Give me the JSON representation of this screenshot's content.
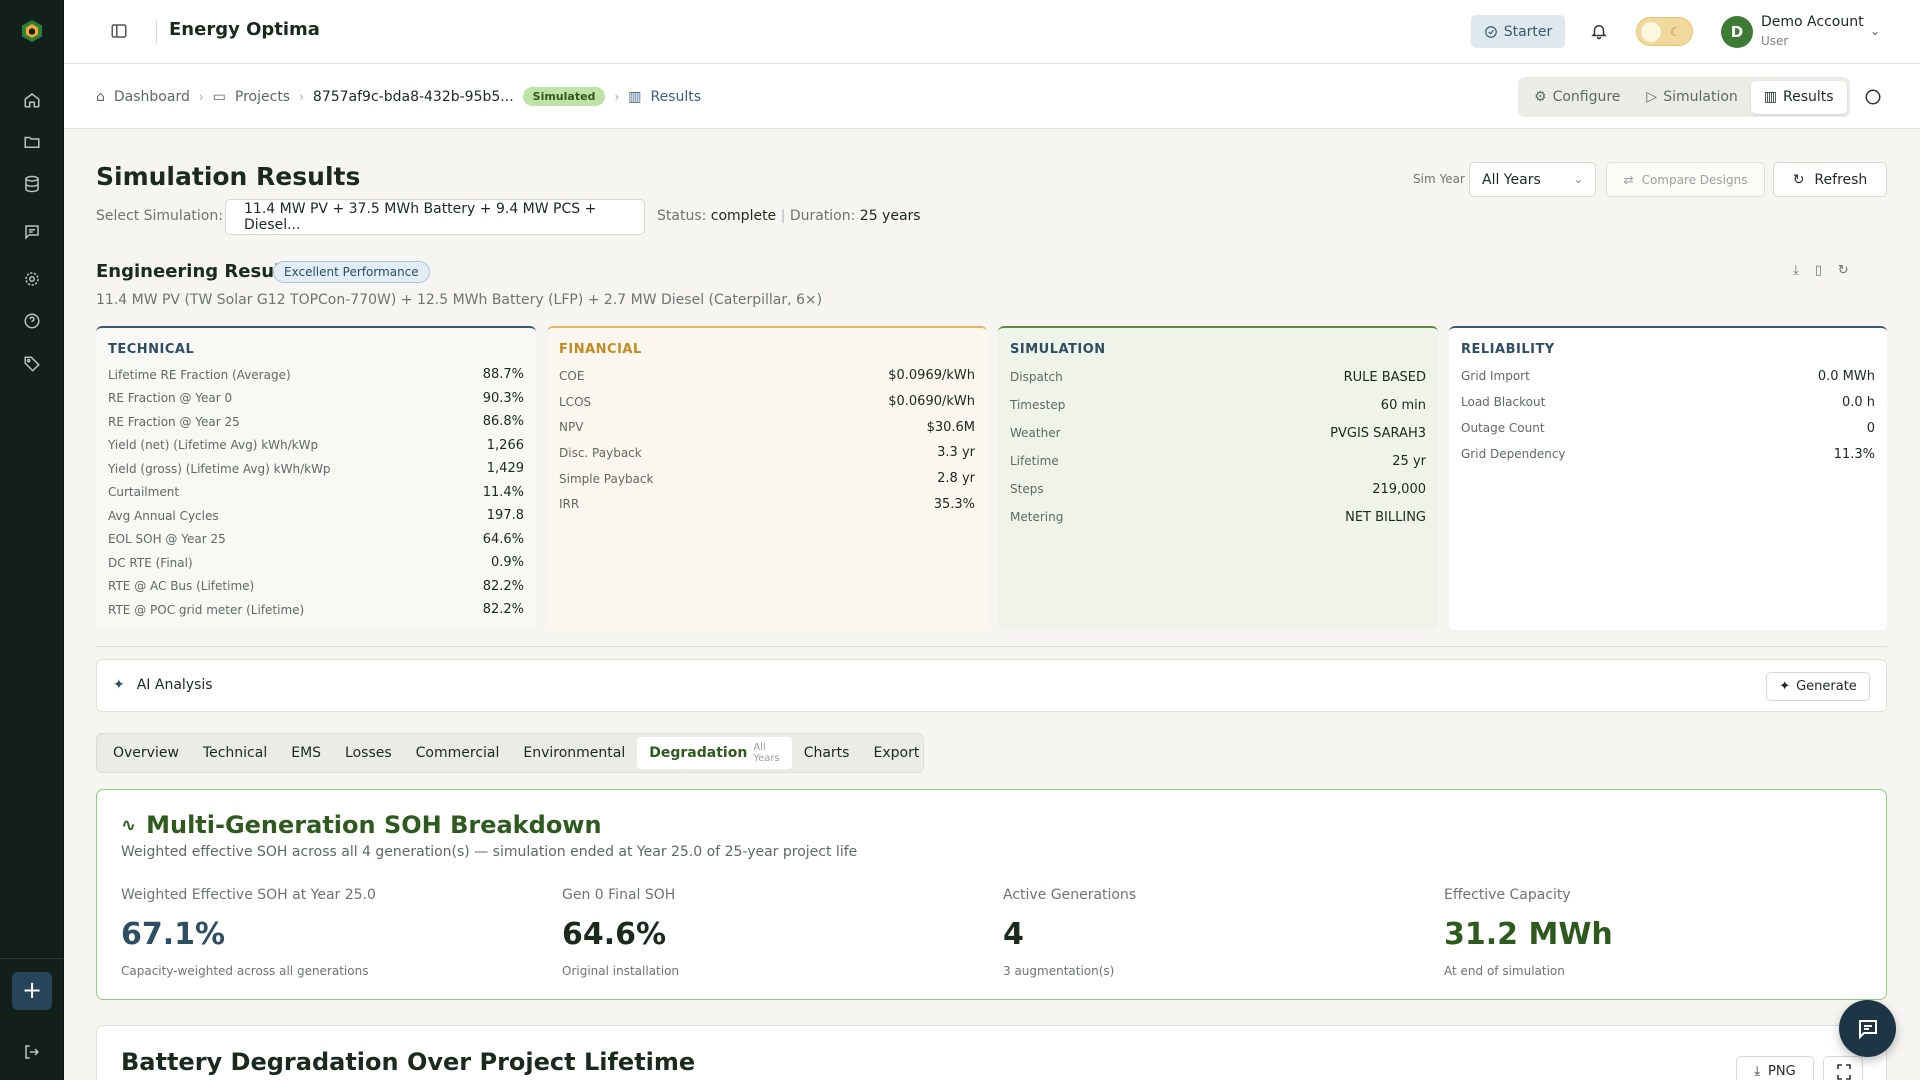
{
  "app": {
    "title": "Energy Optima",
    "plan": "Starter",
    "account_name": "Demo Account",
    "account_role": "User",
    "avatar_letter": "D"
  },
  "sidebar": {
    "items": [
      "home-icon",
      "folder-icon",
      "database-icon",
      "message-icon",
      "settings-icon",
      "help-icon",
      "tag-icon"
    ],
    "add_label": "+"
  },
  "breadcrumb": {
    "dashboard": "Dashboard",
    "projects": "Projects",
    "project_id": "8757af9c-bda8-432b-95b5...",
    "status_badge": "Simulated",
    "results": "Results"
  },
  "view_tabs": {
    "configure": "Configure",
    "simulation": "Simulation",
    "results": "Results"
  },
  "page": {
    "title": "Simulation Results",
    "sim_year_label": "Sim Year",
    "sim_year_value": "All Years",
    "compare_label": "Compare Designs",
    "refresh_label": "Refresh",
    "select_sim_label": "Select Simulation:",
    "selected_sim": "11.4 MW PV + 37.5 MWh Battery + 9.4 MW PCS + Diesel...",
    "status_label": "Status:",
    "status_value": "complete",
    "duration_label": "Duration:",
    "duration_value": "25 years"
  },
  "engineering": {
    "title": "Engineering Results",
    "badge": "Excellent Performance",
    "subtitle": "11.4 MW PV (TW Solar G12 TOPCon-770W) + 12.5 MWh Battery (LFP) + 2.7 MW Diesel (Caterpillar, 6×)"
  },
  "technical": {
    "title": "TECHNICAL",
    "rows": [
      {
        "label": "Lifetime RE Fraction (Average)",
        "value": "88.7%"
      },
      {
        "label": "RE Fraction @ Year 0",
        "value": "90.3%"
      },
      {
        "label": "RE Fraction @ Year 25",
        "value": "86.8%"
      },
      {
        "label": "Yield (net) (Lifetime Avg) kWh/kWp",
        "value": "1,266"
      },
      {
        "label": "Yield (gross) (Lifetime Avg) kWh/kWp",
        "value": "1,429"
      },
      {
        "label": "Curtailment",
        "value": "11.4%"
      },
      {
        "label": "Avg Annual Cycles",
        "value": "197.8"
      },
      {
        "label": "EOL SOH @ Year 25",
        "value": "64.6%"
      },
      {
        "label": "DC RTE (Final)",
        "value": "0.9%"
      },
      {
        "label": "RTE @ AC Bus (Lifetime)",
        "value": "82.2%"
      },
      {
        "label": "RTE @ POC grid meter (Lifetime)",
        "value": "82.2%"
      }
    ]
  },
  "financial": {
    "title": "FINANCIAL",
    "rows": [
      {
        "label": "COE",
        "value": "$0.0969/kWh"
      },
      {
        "label": "LCOS",
        "value": "$0.0690/kWh"
      },
      {
        "label": "NPV",
        "value": "$30.6M"
      },
      {
        "label": "Disc. Payback",
        "value": "3.3 yr"
      },
      {
        "label": "Simple Payback",
        "value": "2.8 yr"
      },
      {
        "label": "IRR",
        "value": "35.3%"
      }
    ]
  },
  "simulation": {
    "title": "SIMULATION",
    "rows": [
      {
        "label": "Dispatch",
        "value": "RULE BASED"
      },
      {
        "label": "Timestep",
        "value": "60 min"
      },
      {
        "label": "Weather",
        "value": "PVGIS SARAH3"
      },
      {
        "label": "Lifetime",
        "value": "25 yr"
      },
      {
        "label": "Steps",
        "value": "219,000"
      },
      {
        "label": "Metering",
        "value": "NET BILLING"
      }
    ]
  },
  "reliability": {
    "title": "RELIABILITY",
    "rows": [
      {
        "label": "Grid Import",
        "value": "0.0 MWh"
      },
      {
        "label": "Load Blackout",
        "value": "0.0 h"
      },
      {
        "label": "Outage Count",
        "value": "0"
      },
      {
        "label": "Grid Dependency",
        "value": "11.3%"
      }
    ]
  },
  "ai": {
    "label": "AI Analysis",
    "generate_label": "Generate"
  },
  "tabs": {
    "items": [
      "Overview",
      "Technical",
      "EMS",
      "Losses",
      "Commercial",
      "Environmental",
      "Degradation",
      "Charts",
      "Export"
    ],
    "active_note": "All Years"
  },
  "soh": {
    "title": "Multi-Generation SOH Breakdown",
    "subtitle": "Weighted effective SOH across all 4 generation(s) — simulation ended at Year 25.0 of 25-year project life",
    "metrics": [
      {
        "label": "Weighted Effective SOH at Year 25.0",
        "value": "67.1%",
        "sub": "Capacity-weighted across all generations",
        "color": "#2f4d63"
      },
      {
        "label": "Gen 0 Final SOH",
        "value": "64.6%",
        "sub": "Original installation",
        "color": "#1a2a1e"
      },
      {
        "label": "Active Generations",
        "value": "4",
        "sub": "3 augmentation(s)",
        "color": "#1a2a1e"
      },
      {
        "label": "Effective Capacity",
        "value": "31.2 MWh",
        "sub": "At end of simulation",
        "color": "#2f5a1f"
      }
    ]
  },
  "degradation": {
    "title": "Battery Degradation Over Project Lifetime",
    "png_label": "PNG"
  }
}
